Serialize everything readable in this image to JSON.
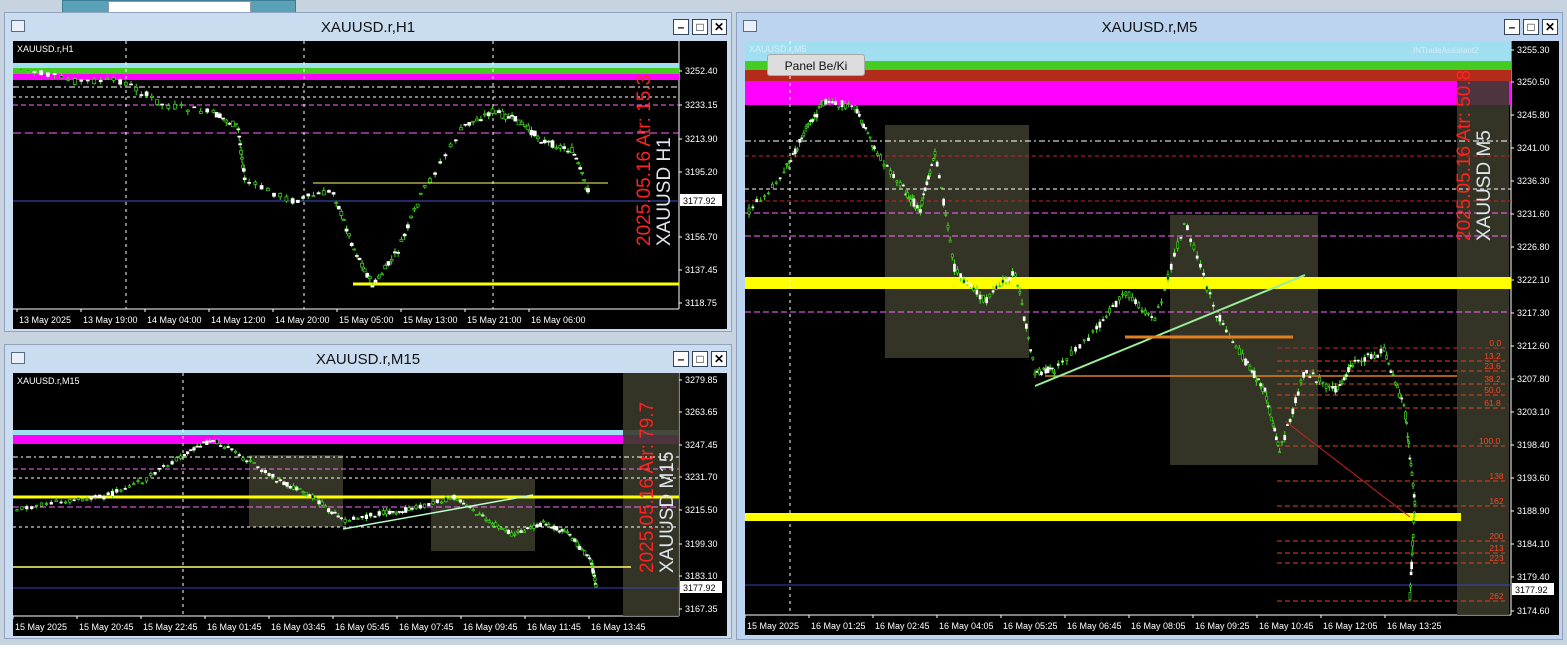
{
  "windows": {
    "h1": {
      "title": "XAUUSD.r,H1",
      "symbol": "XAUUSD.r,H1",
      "watermark_date": "2025.05.16 Atr: 15.3",
      "watermark_symbol": "XAUUSD H1",
      "price_ticks": [
        "3252.40",
        "3233.15",
        "3213.90",
        "3195.20",
        "3177.92",
        "3156.70",
        "3137.45",
        "3118.75"
      ],
      "current_price": "3177.92",
      "time_ticks": [
        "13 May 2025",
        "13 May 19:00",
        "14 May 04:00",
        "14 May 12:00",
        "14 May 20:00",
        "15 May 05:00",
        "15 May 13:00",
        "15 May 21:00",
        "16 May 06:00"
      ]
    },
    "m15": {
      "title": "XAUUSD.r,M15",
      "symbol": "XAUUSD.r,M15",
      "watermark_date": "2025.05.16 Atr: 79.7",
      "watermark_symbol": "XAUUSD M15",
      "price_ticks": [
        "3279.85",
        "3263.65",
        "3247.45",
        "3231.70",
        "3215.50",
        "3199.30",
        "3183.10",
        "3177.92",
        "3167.35"
      ],
      "current_price": "3177.92",
      "time_ticks": [
        "15 May 2025",
        "15 May 20:45",
        "15 May 22:45",
        "16 May 01:45",
        "16 May 03:45",
        "16 May 05:45",
        "16 May 07:45",
        "16 May 09:45",
        "16 May 11:45",
        "16 May 13:45"
      ]
    },
    "m5": {
      "title": "XAUUSD.r,M5",
      "symbol": "XAUUSD.r,M5",
      "indicator_label": "INTradeAssistant2",
      "watermark_date": "2025.05.16 Atr: 50.8",
      "watermark_symbol": "XAUUSD M5",
      "panel_button": "Panel Be/Ki",
      "price_ticks": [
        "3255.30",
        "3250.50",
        "3245.80",
        "3241.00",
        "3236.30",
        "3231.60",
        "3226.80",
        "3222.10",
        "3217.30",
        "3212.60",
        "3207.80",
        "3203.10",
        "3198.40",
        "3193.60",
        "3188.90",
        "3184.10",
        "3179.40",
        "3177.92",
        "3174.60"
      ],
      "current_price": "3177.92",
      "fib_levels": [
        "0.0",
        "13.2",
        "23.6",
        "38.2",
        "50.0",
        "61.8",
        "100.0",
        "138",
        "162",
        "200",
        "213",
        "223",
        "262"
      ],
      "time_ticks": [
        "15 May 2025",
        "16 May 01:25",
        "16 May 02:45",
        "16 May 04:05",
        "16 May 05:25",
        "16 May 06:45",
        "16 May 08:05",
        "16 May 09:25",
        "16 May 10:45",
        "16 May 12:05",
        "16 May 13:25"
      ]
    }
  },
  "colors": {
    "candle_up": "#ffffff",
    "wick": "#44dd22",
    "magenta_zone": "#ff00ff",
    "green_zone": "#44cc22",
    "cyan_zone": "#9fdff0",
    "yellow_line": "#ffff00",
    "red_text": "#ff2222",
    "box_fill": "#3a3a2a"
  }
}
